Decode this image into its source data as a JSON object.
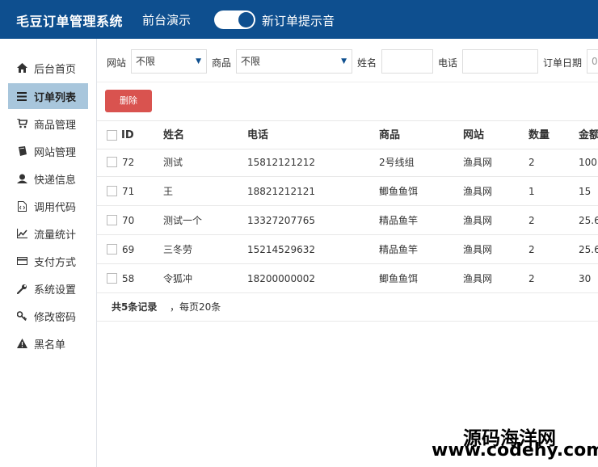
{
  "header": {
    "title": "毛豆订单管理系统",
    "demo_label": "前台演示",
    "notify_label": "新订单提示音",
    "notify_on": true
  },
  "sidebar": {
    "items": [
      {
        "label": "后台首页",
        "icon": "home-icon",
        "active": false
      },
      {
        "label": "订单列表",
        "icon": "list-icon",
        "active": true
      },
      {
        "label": "商品管理",
        "icon": "cart-icon",
        "active": false
      },
      {
        "label": "网站管理",
        "icon": "book-icon",
        "active": false
      },
      {
        "label": "快递信息",
        "icon": "courier-icon",
        "active": false
      },
      {
        "label": "调用代码",
        "icon": "code-file-icon",
        "active": false
      },
      {
        "label": "流量统计",
        "icon": "line-chart-icon",
        "active": false
      },
      {
        "label": "支付方式",
        "icon": "credit-card-icon",
        "active": false
      },
      {
        "label": "系统设置",
        "icon": "wrench-icon",
        "active": false
      },
      {
        "label": "修改密码",
        "icon": "key-icon",
        "active": false
      },
      {
        "label": "黑名单",
        "icon": "warning-icon",
        "active": false
      }
    ]
  },
  "filters": {
    "site_label": "网站",
    "site_value": "不限",
    "product_label": "商品",
    "product_value": "不限",
    "name_label": "姓名",
    "name_value": "",
    "phone_label": "电话",
    "phone_value": "",
    "date_label": "订单日期",
    "date_value": "0"
  },
  "actions": {
    "delete_label": "删除"
  },
  "table": {
    "headers": [
      "ID",
      "姓名",
      "电话",
      "商品",
      "网站",
      "数量",
      "金额"
    ],
    "rows": [
      [
        "72",
        "测试",
        "15812121212",
        "2号线组",
        "渔具网",
        "2",
        "100"
      ],
      [
        "71",
        "王",
        "18821212121",
        "鲫鱼鱼饵",
        "渔具网",
        "1",
        "15"
      ],
      [
        "70",
        "测试一个",
        "13327207765",
        "精品鱼竿",
        "渔具网",
        "2",
        "25.6"
      ],
      [
        "69",
        "三冬劳",
        "15214529632",
        "精品鱼竿",
        "渔具网",
        "2",
        "25.6"
      ],
      [
        "58",
        "令狐冲",
        "18200000002",
        "鲫鱼鱼饵",
        "渔具网",
        "2",
        "30"
      ]
    ]
  },
  "summary": {
    "total": "共5条记录",
    "per_page": "，每页20条"
  },
  "watermark": {
    "line1": "源码海洋网",
    "line2": "www.codehy.com"
  },
  "colors": {
    "header_bg": "#0e4f8f",
    "active_nav_bg": "#a8c6dc",
    "delete_btn": "#d9534f"
  }
}
